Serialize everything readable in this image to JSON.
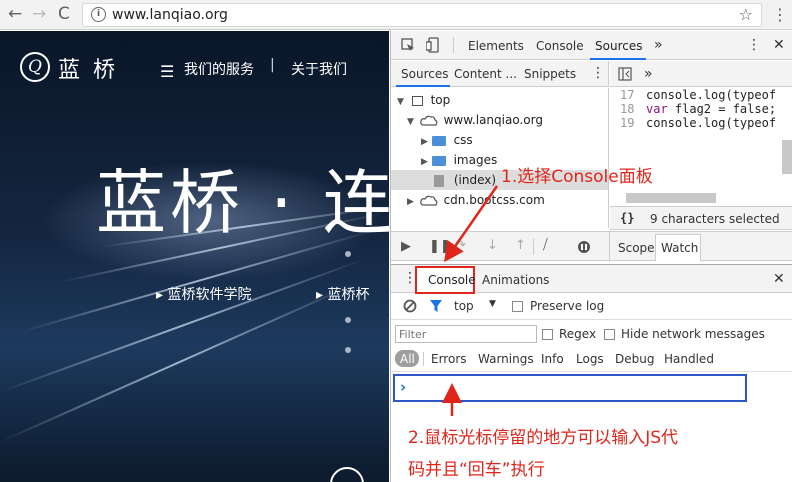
{
  "browser": {
    "url": "www.lanqiao.org",
    "back_icon": "←",
    "forward_icon": "→",
    "reload_icon": "C",
    "info_icon": "i",
    "star_icon": "☆",
    "menu_icon": "⋮"
  },
  "page": {
    "brand": "蓝 桥",
    "logo_glyph": "Q",
    "menu_icon": "☰",
    "nav": [
      "我们的服务",
      "|",
      "关于我们"
    ],
    "hero": "蓝桥 · 连",
    "sub1": "▸  蓝桥软件学院",
    "sub2": "▸  蓝桥杯"
  },
  "devtools": {
    "tabs": [
      "Elements",
      "Console",
      "Sources",
      "»"
    ],
    "close": "✕",
    "kebab": "⋮",
    "nav_tabs": [
      "Sources",
      "Content ...",
      "Snippets"
    ],
    "tree": {
      "top": "top",
      "domain": "www.lanqiao.org",
      "css": "css",
      "images": "images",
      "index": "(index)",
      "cdn": "cdn.bootcss.com"
    },
    "code_lines": [
      {
        "n": "17",
        "text": "console.log(typeof"
      },
      {
        "n": "18",
        "text": "var flag2 = false;"
      },
      {
        "n": "19",
        "text": "console.log(typeof"
      }
    ],
    "code_kw": "var",
    "selected": "9 characters selected",
    "braces": "{}",
    "scope": "Scope",
    "watch": "Watch",
    "drawer_tabs": [
      "Console",
      "Animations"
    ],
    "context": "top",
    "preserve_log": "Preserve log",
    "filter_placeholder": "Filter",
    "regex": "Regex",
    "hide_network": "Hide network messages",
    "levels": [
      "All",
      "Errors",
      "Warnings",
      "Info",
      "Logs",
      "Debug",
      "Handled"
    ],
    "prompt": "›"
  },
  "annotations": {
    "a1": "1.选择Console面板",
    "a2_line1": "2.鼠标光标停留的地方可以输入JS代",
    "a2_line2": "码并且“回车”执行"
  },
  "colors": {
    "annotation": "#e0261b",
    "highlight_box": "#2f56c8",
    "accent_blue": "#1a73e8"
  }
}
